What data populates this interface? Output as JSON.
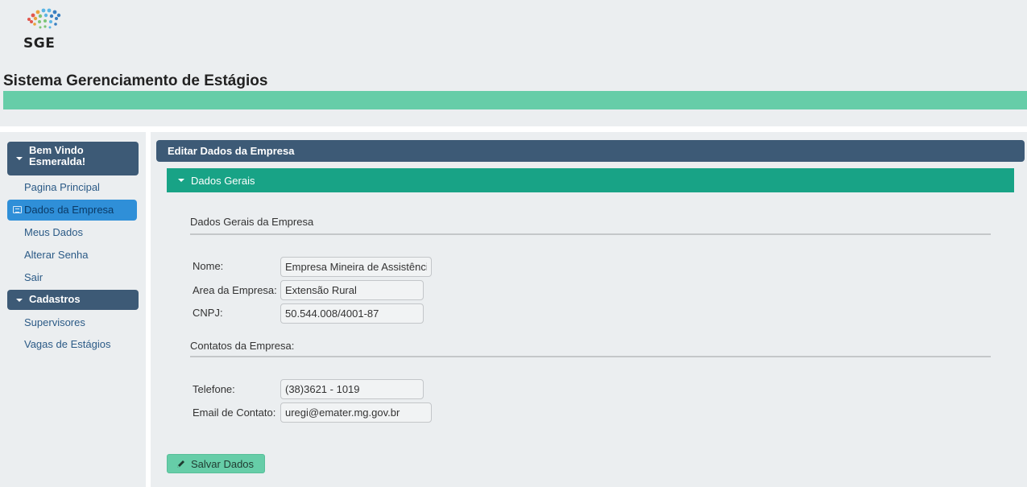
{
  "header": {
    "logo_text": "SGE",
    "app_title": "Sistema Gerenciamento de Estágios",
    "accent_color": "#66cda8"
  },
  "sidebar": {
    "welcome_header": "Bem Vindo Esmeralda!",
    "links": [
      {
        "label": "Pagina Principal"
      },
      {
        "label": "Dados da Empresa",
        "active": true,
        "icon": "id-card-icon"
      },
      {
        "label": "Meus Dados"
      },
      {
        "label": "Alterar Senha"
      },
      {
        "label": "Sair"
      }
    ],
    "cadastros_header": "Cadastros",
    "cadastros_links": [
      {
        "label": "Supervisores"
      },
      {
        "label": "Vagas de Estágios"
      }
    ]
  },
  "main": {
    "panel_title": "Editar Dados da Empresa",
    "section_title": "Dados Gerais",
    "general_heading": "Dados Gerais da Empresa",
    "fields": {
      "nome_label": "Nome:",
      "nome_value": "Empresa Mineira de Assistência Técnica e Extensão Rural",
      "area_label": "Area da Empresa:",
      "area_value": "Extensão Rural",
      "cnpj_label": "CNPJ:",
      "cnpj_value": "50.544.008/4001-87"
    },
    "contacts_heading": "Contatos da Empresa:",
    "contacts": {
      "telefone_label": "Telefone:",
      "telefone_value": "(38)3621 - 1019",
      "email_label": "Email de Contato:",
      "email_value": "uregi@emater.mg.gov.br"
    },
    "save_label": "Salvar Dados",
    "save_icon": "pencil-icon"
  },
  "colors": {
    "nav_header": "#3d5a76",
    "section_header": "#18a386",
    "active_link": "#2f8fd8",
    "background": "#ebeef0"
  }
}
